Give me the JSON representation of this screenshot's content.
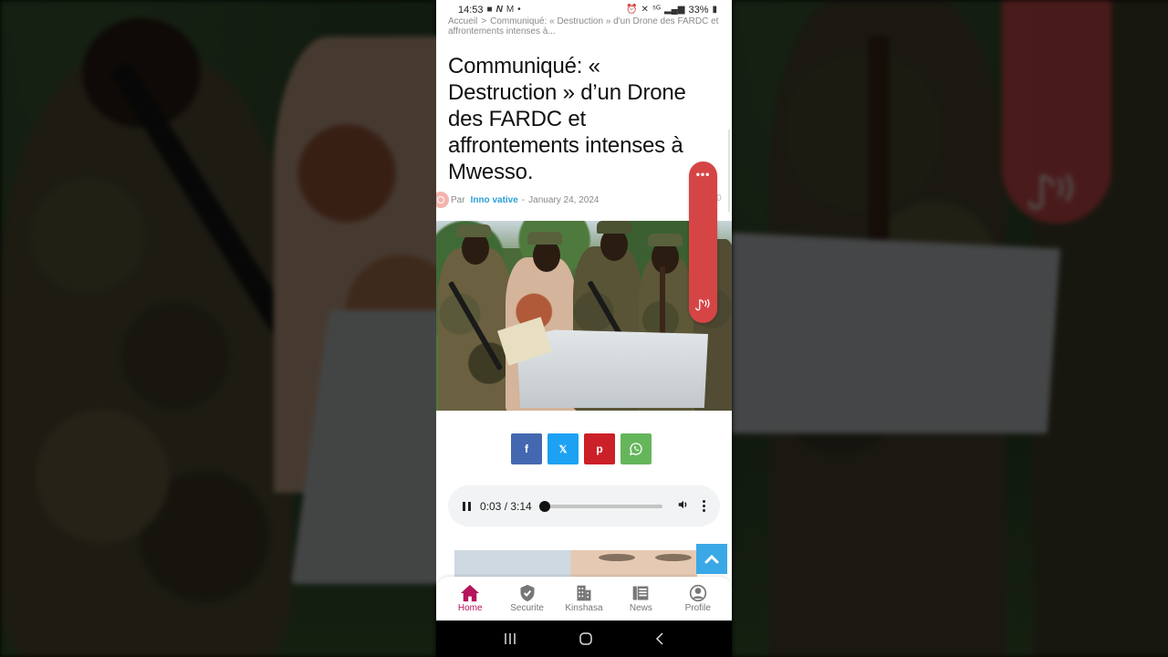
{
  "status_bar": {
    "time": "14:53",
    "battery": "33%",
    "left_icons": [
      "video-icon",
      "n-app-icon",
      "gmail-icon",
      "dot-icon"
    ],
    "right_icons": [
      "alarm-icon",
      "mute-icon",
      "5g-icon",
      "signal-icon",
      "battery-icon"
    ]
  },
  "breadcrumb": {
    "home": "Accueil",
    "separator": ">",
    "current": "Communiqué: « Destruction » d'un Drone des FARDC et affrontements intenses à..."
  },
  "article": {
    "title": "Communiqué: « Destruction » d’un Drone des FARDC et affrontements intenses à Mwesso.",
    "by_label": "Par",
    "author": "Inno vative",
    "date_separator": "-",
    "date": "January 24, 2024",
    "image_alt": "Soldiers holding wreckage of a drone",
    "side_counter": "0"
  },
  "side_pill": {
    "menu_icon": "more-dots-icon",
    "audio_icon": "music-wave-icon",
    "color": "#d64545"
  },
  "share": {
    "buttons": [
      {
        "network": "facebook",
        "glyph": "f",
        "color": "#4468b0"
      },
      {
        "network": "x",
        "glyph": "𝕏",
        "color": "#1da1f2"
      },
      {
        "network": "pinterest",
        "glyph": "p",
        "color": "#cb2027"
      },
      {
        "network": "whatsapp",
        "glyph": "whatsapp-icon",
        "color": "#65b65b"
      }
    ]
  },
  "audio_player": {
    "state": "playing",
    "current_time": "0:03",
    "separator": "/",
    "duration": "3:14",
    "time_display": "0:03 / 3:14",
    "progress_fraction": 0.015
  },
  "scroll_top": {
    "icon": "chevron-up-icon",
    "color": "#3aa8e6"
  },
  "bottom_nav": {
    "active_color": "#b5135d",
    "items": [
      {
        "label": "Home",
        "icon": "home-icon",
        "active": true
      },
      {
        "label": "Securite",
        "icon": "shield-check-icon",
        "active": false
      },
      {
        "label": "Kinshasa",
        "icon": "building-icon",
        "active": false
      },
      {
        "label": "News",
        "icon": "newspaper-icon",
        "active": false
      },
      {
        "label": "Profile",
        "icon": "user-circle-icon",
        "active": false
      }
    ]
  },
  "android_nav": {
    "buttons": [
      "recents-icon",
      "home-circle-icon",
      "back-icon"
    ]
  }
}
